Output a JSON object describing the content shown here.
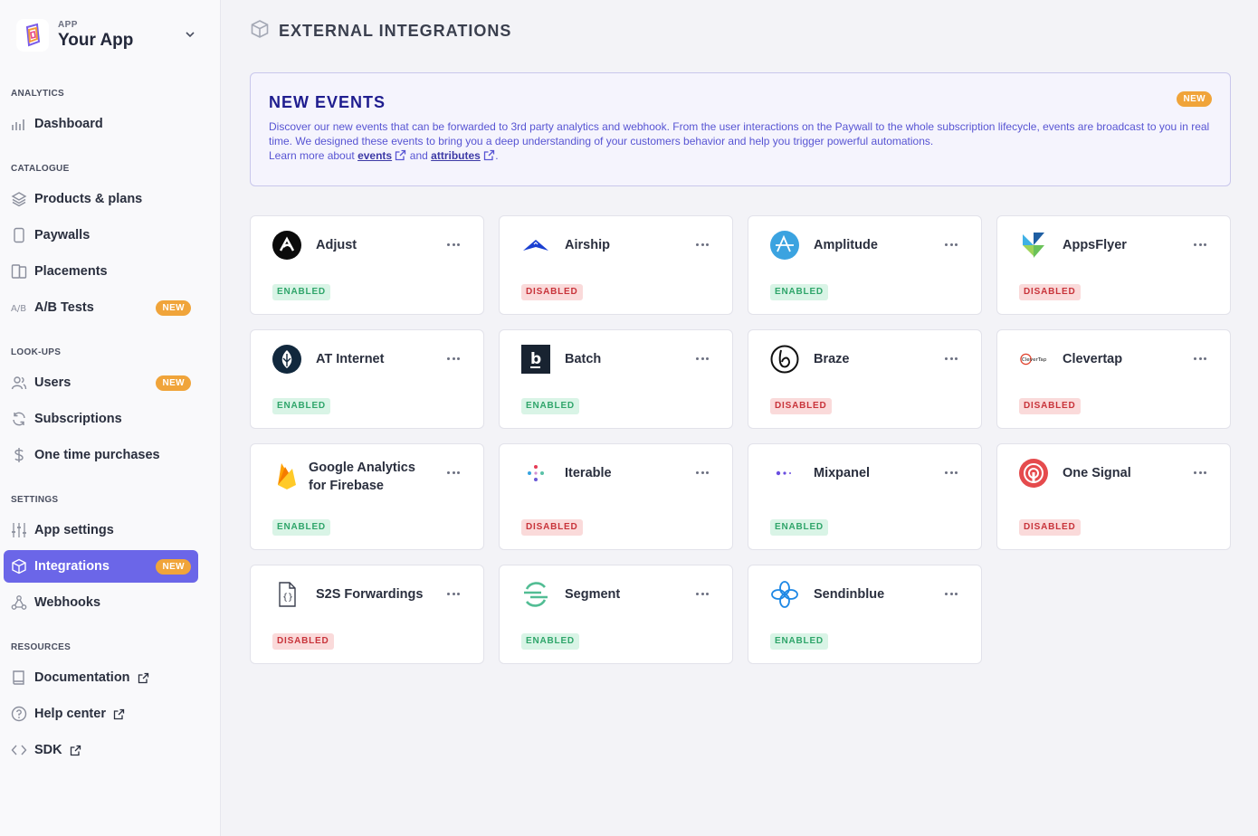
{
  "app": {
    "kicker": "APP",
    "name": "Your App"
  },
  "sidebar": {
    "sections": [
      {
        "label": "ANALYTICS"
      },
      {
        "label": "CATALOGUE"
      },
      {
        "label": "LOOK-UPS"
      },
      {
        "label": "SETTINGS"
      },
      {
        "label": "RESOURCES"
      }
    ],
    "items": [
      {
        "label": "Dashboard",
        "icon": "chart-icon"
      },
      {
        "label": "Products & plans",
        "icon": "layers-icon"
      },
      {
        "label": "Paywalls",
        "icon": "phone-icon"
      },
      {
        "label": "Placements",
        "icon": "placements-icon"
      },
      {
        "label": "A/B Tests",
        "icon": "ab-icon",
        "badge": "NEW"
      },
      {
        "label": "Users",
        "icon": "users-icon",
        "badge": "NEW"
      },
      {
        "label": "Subscriptions",
        "icon": "refresh-icon"
      },
      {
        "label": "One time purchases",
        "icon": "dollar-icon"
      },
      {
        "label": "App settings",
        "icon": "sliders-icon"
      },
      {
        "label": "Integrations",
        "icon": "cube-icon",
        "badge": "NEW",
        "active": true
      },
      {
        "label": "Webhooks",
        "icon": "webhook-icon"
      },
      {
        "label": "Documentation",
        "icon": "book-icon"
      },
      {
        "label": "Help center",
        "icon": "help-icon"
      },
      {
        "label": "SDK",
        "icon": "code-icon"
      }
    ]
  },
  "header": {
    "title": "EXTERNAL INTEGRATIONS"
  },
  "banner": {
    "title": "NEW EVENTS",
    "badge": "NEW",
    "text": "Discover our new events that can be forwarded to 3rd party analytics and webhook. From the user interactions on the Paywall to the whole subscription lifecycle, events are broadcast to you in real time. We designed these events to bring you a deep understanding of your customers behavior and help you trigger powerful automations.",
    "learn_prefix": "Learn more about",
    "link_events": "events",
    "and": "and",
    "link_attributes": "attributes",
    "suffix": "."
  },
  "integrations": [
    {
      "name": "Adjust",
      "status": "ENABLED"
    },
    {
      "name": "Airship",
      "status": "DISABLED"
    },
    {
      "name": "Amplitude",
      "status": "ENABLED"
    },
    {
      "name": "AppsFlyer",
      "status": "DISABLED"
    },
    {
      "name": "AT Internet",
      "status": "ENABLED"
    },
    {
      "name": "Batch",
      "status": "ENABLED"
    },
    {
      "name": "Braze",
      "status": "DISABLED"
    },
    {
      "name": "Clevertap",
      "status": "DISABLED"
    },
    {
      "name": "Google Analytics for Firebase",
      "status": "ENABLED"
    },
    {
      "name": "Iterable",
      "status": "DISABLED"
    },
    {
      "name": "Mixpanel",
      "status": "ENABLED"
    },
    {
      "name": "One Signal",
      "status": "DISABLED"
    },
    {
      "name": "S2S Forwardings",
      "status": "DISABLED"
    },
    {
      "name": "Segment",
      "status": "ENABLED"
    },
    {
      "name": "Sendinblue",
      "status": "ENABLED"
    }
  ],
  "clevertap_logo_text": "CleverTap",
  "batch_logo_text": "b",
  "s2s_logo_text": "{}",
  "colors": {
    "accent": "#6b66e8",
    "badge": "#f0a43a",
    "enabled_bg": "#d9f4e6",
    "disabled_bg": "#fadada"
  }
}
